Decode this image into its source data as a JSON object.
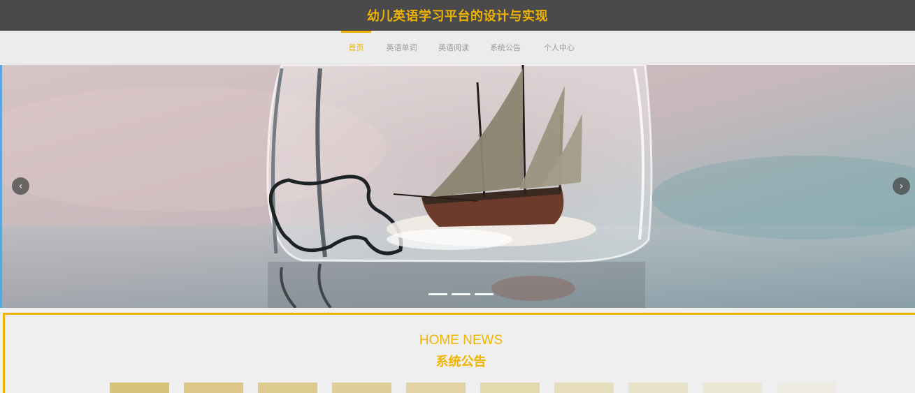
{
  "header": {
    "title": "幼儿英语学习平台的设计与实现"
  },
  "nav": {
    "items": [
      {
        "label": "首页",
        "active": true
      },
      {
        "label": "英语单词",
        "active": false
      },
      {
        "label": "英语阅读",
        "active": false
      },
      {
        "label": "系统公告",
        "active": false
      },
      {
        "label": "个人中心",
        "active": false
      }
    ]
  },
  "carousel": {
    "prev_icon": "chevron-left-icon",
    "next_icon": "chevron-right-icon",
    "slide_count": 3,
    "active_slide": 1,
    "prev_glyph": "‹",
    "next_glyph": "›"
  },
  "news": {
    "title_en": "HOME NEWS",
    "title_cn": "系统公告",
    "tile_colors": [
      "#d9c27a",
      "#dcc789",
      "#ddca8f",
      "#dfce97",
      "#e1d3a3",
      "#e3d8ae",
      "#e6ddbb",
      "#e9e3c9",
      "#ece8d6",
      "#eeece2"
    ]
  },
  "colors": {
    "accent": "#f0b400",
    "topbar": "#4a4a4c",
    "nav_text": "#9a9a9a"
  }
}
